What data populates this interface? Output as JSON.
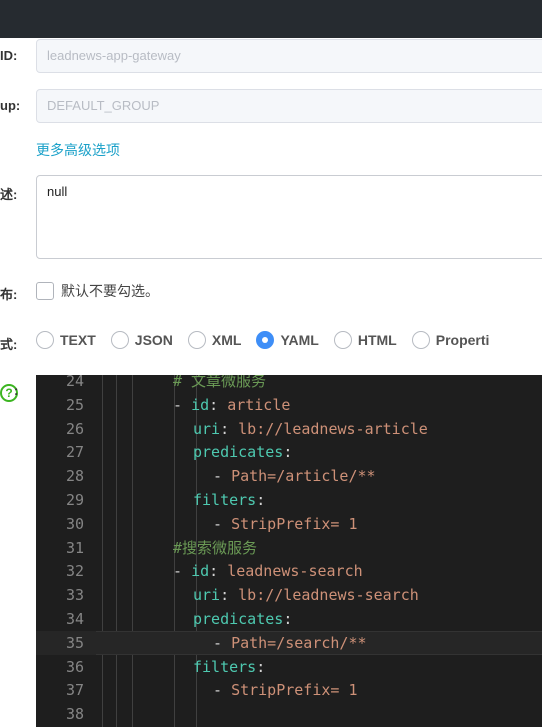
{
  "form": {
    "data_id_label": "ID:",
    "data_id_value": "leadnews-app-gateway",
    "group_label": "up:",
    "group_value": "DEFAULT_GROUP",
    "advanced_link": "更多高级选项",
    "desc_label": "述:",
    "desc_value": "null",
    "beta_label": "布:",
    "beta_checkbox_text": "默认不要勾选。",
    "format_label": "式:",
    "formats": [
      "TEXT",
      "JSON",
      "XML",
      "YAML",
      "HTML",
      "Properti"
    ],
    "selected_format": "YAML",
    "content_colon": ":",
    "help_icon_glyph": "?"
  },
  "editor": {
    "lines": [
      {
        "num": "24",
        "indent": 2,
        "parts": [
          {
            "t": "# 文章微服务",
            "c": "comment"
          }
        ]
      },
      {
        "num": "25",
        "indent": 2,
        "parts": [
          {
            "t": "- ",
            "c": "punc"
          },
          {
            "t": "id",
            "c": "key"
          },
          {
            "t": ": ",
            "c": "punc"
          },
          {
            "t": "article",
            "c": "str"
          }
        ]
      },
      {
        "num": "26",
        "indent": 3,
        "parts": [
          {
            "t": "uri",
            "c": "key"
          },
          {
            "t": ": ",
            "c": "punc"
          },
          {
            "t": "lb://leadnews-article",
            "c": "str"
          }
        ]
      },
      {
        "num": "27",
        "indent": 3,
        "parts": [
          {
            "t": "predicates",
            "c": "key"
          },
          {
            "t": ":",
            "c": "punc"
          }
        ]
      },
      {
        "num": "28",
        "indent": 4,
        "parts": [
          {
            "t": "- ",
            "c": "punc"
          },
          {
            "t": "Path=/article/**",
            "c": "str"
          }
        ]
      },
      {
        "num": "29",
        "indent": 3,
        "parts": [
          {
            "t": "filters",
            "c": "key"
          },
          {
            "t": ":",
            "c": "punc"
          }
        ]
      },
      {
        "num": "30",
        "indent": 4,
        "parts": [
          {
            "t": "- ",
            "c": "punc"
          },
          {
            "t": "StripPrefix= 1",
            "c": "str"
          }
        ]
      },
      {
        "num": "31",
        "indent": 2,
        "parts": [
          {
            "t": "#搜索微服务",
            "c": "comment"
          }
        ]
      },
      {
        "num": "32",
        "indent": 2,
        "parts": [
          {
            "t": "- ",
            "c": "punc"
          },
          {
            "t": "id",
            "c": "key"
          },
          {
            "t": ": ",
            "c": "punc"
          },
          {
            "t": "leadnews-search",
            "c": "str"
          }
        ]
      },
      {
        "num": "33",
        "indent": 3,
        "parts": [
          {
            "t": "uri",
            "c": "key"
          },
          {
            "t": ": ",
            "c": "punc"
          },
          {
            "t": "lb://leadnews-search",
            "c": "str"
          }
        ]
      },
      {
        "num": "34",
        "indent": 3,
        "parts": [
          {
            "t": "predicates",
            "c": "key"
          },
          {
            "t": ":",
            "c": "punc"
          }
        ]
      },
      {
        "num": "35",
        "indent": 4,
        "parts": [
          {
            "t": "- ",
            "c": "punc"
          },
          {
            "t": "Path=/search/**",
            "c": "str"
          }
        ],
        "current": true
      },
      {
        "num": "36",
        "indent": 3,
        "parts": [
          {
            "t": "filters",
            "c": "key"
          },
          {
            "t": ":",
            "c": "punc"
          }
        ]
      },
      {
        "num": "37",
        "indent": 4,
        "parts": [
          {
            "t": "- ",
            "c": "punc"
          },
          {
            "t": "StripPrefix= 1",
            "c": "str"
          }
        ]
      },
      {
        "num": "38",
        "indent": 0,
        "parts": []
      }
    ]
  },
  "colors": {
    "accent": "#3e8ef7",
    "link": "#1ba1c9",
    "help": "#3cb521",
    "editor_bg": "#1e1e1e",
    "topbar": "#262b30"
  }
}
